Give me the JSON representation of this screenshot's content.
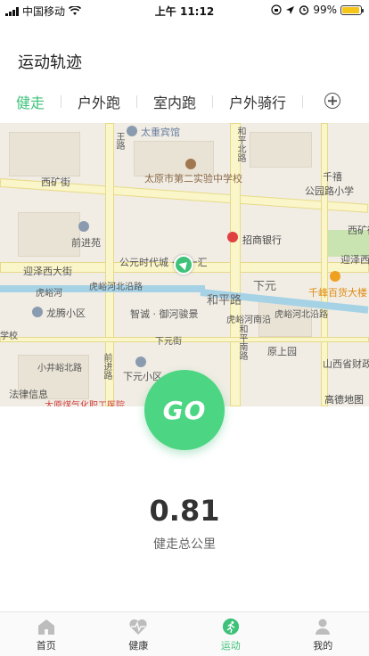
{
  "status_bar": {
    "carrier": "中国移动",
    "time": "上午 11:12",
    "battery": "99%"
  },
  "title": "运动轨迹",
  "tabs": [
    {
      "label": "健走",
      "active": true
    },
    {
      "label": "户外跑",
      "active": false
    },
    {
      "label": "室内跑",
      "active": false
    },
    {
      "label": "户外骑行",
      "active": false
    }
  ],
  "map": {
    "labels": {
      "hotel": "太重宾馆",
      "school": "太原市第二实验中学校",
      "gongyuan_school": "公园路小学",
      "xikuang_st": "西矿街",
      "xikuang_st2": "西矿街",
      "qianjin_yuan": "前进苑",
      "bank": "招商银行",
      "mall": "公元时代城 · 新一汇",
      "yingze": "迎泽西大街",
      "yingze2": "迎泽西大",
      "hupan": "虎峪河北沿路",
      "huyu": "虎峪河",
      "heping_rd": "和平路",
      "xiayuan": "下元",
      "qianfeng": "千峰百货大楼",
      "longteng": "龙腾小区",
      "zhicheng": "智诚 · 御河骏景",
      "huyu_south": "虎峪河南沿",
      "huyu_north2": "虎峪河北沿路",
      "xiayuan_st": "下元街",
      "yuanshang": "原上园",
      "xiayuan_xq": "下元小区",
      "shanxi_fin": "山西省财政",
      "xiaojing": "小井峪北路",
      "falv": "法律信息",
      "gaode": "高德地图",
      "hospital": "太原煤气化职工医院",
      "qianjin_rd": "前进路",
      "heping_north": "和平北路",
      "heping_south": "和平南路",
      "qiansheng": "千禧",
      "wangzhe": "王路",
      "jiaoxiao": "学校"
    }
  },
  "go_button": "GO",
  "distance": {
    "value": "0.81",
    "label": "健走总公里"
  },
  "bottom_nav": [
    {
      "label": "首页",
      "icon": "home-icon",
      "active": false
    },
    {
      "label": "健康",
      "icon": "heart-pulse-icon",
      "active": false
    },
    {
      "label": "运动",
      "icon": "runner-icon",
      "active": true
    },
    {
      "label": "我的",
      "icon": "person-icon",
      "active": false
    }
  ],
  "colors": {
    "accent": "#3ec27a",
    "go_button": "#4cd582",
    "battery": "#f5c518"
  }
}
